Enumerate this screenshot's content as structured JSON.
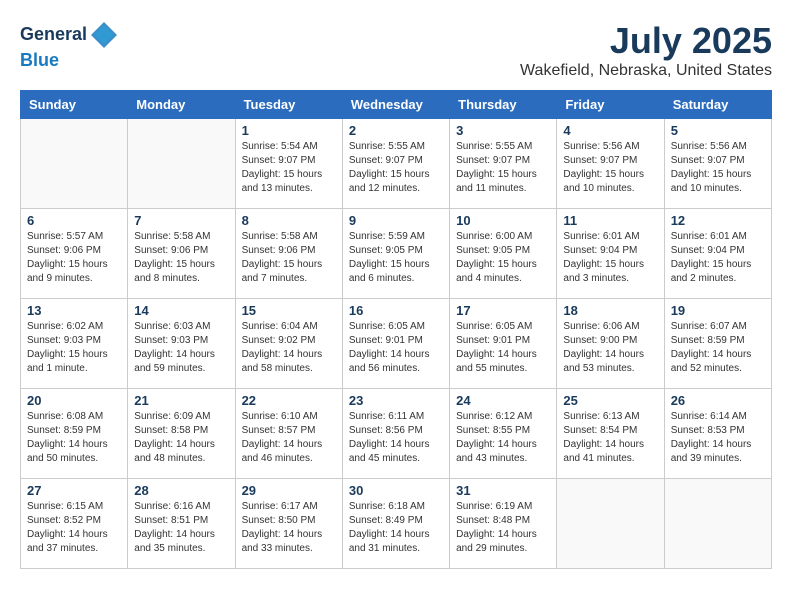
{
  "header": {
    "logo_line1": "General",
    "logo_line2": "Blue",
    "month_year": "July 2025",
    "location": "Wakefield, Nebraska, United States"
  },
  "days_of_week": [
    "Sunday",
    "Monday",
    "Tuesday",
    "Wednesday",
    "Thursday",
    "Friday",
    "Saturday"
  ],
  "weeks": [
    [
      {
        "num": "",
        "info": ""
      },
      {
        "num": "",
        "info": ""
      },
      {
        "num": "1",
        "info": "Sunrise: 5:54 AM\nSunset: 9:07 PM\nDaylight: 15 hours\nand 13 minutes."
      },
      {
        "num": "2",
        "info": "Sunrise: 5:55 AM\nSunset: 9:07 PM\nDaylight: 15 hours\nand 12 minutes."
      },
      {
        "num": "3",
        "info": "Sunrise: 5:55 AM\nSunset: 9:07 PM\nDaylight: 15 hours\nand 11 minutes."
      },
      {
        "num": "4",
        "info": "Sunrise: 5:56 AM\nSunset: 9:07 PM\nDaylight: 15 hours\nand 10 minutes."
      },
      {
        "num": "5",
        "info": "Sunrise: 5:56 AM\nSunset: 9:07 PM\nDaylight: 15 hours\nand 10 minutes."
      }
    ],
    [
      {
        "num": "6",
        "info": "Sunrise: 5:57 AM\nSunset: 9:06 PM\nDaylight: 15 hours\nand 9 minutes."
      },
      {
        "num": "7",
        "info": "Sunrise: 5:58 AM\nSunset: 9:06 PM\nDaylight: 15 hours\nand 8 minutes."
      },
      {
        "num": "8",
        "info": "Sunrise: 5:58 AM\nSunset: 9:06 PM\nDaylight: 15 hours\nand 7 minutes."
      },
      {
        "num": "9",
        "info": "Sunrise: 5:59 AM\nSunset: 9:05 PM\nDaylight: 15 hours\nand 6 minutes."
      },
      {
        "num": "10",
        "info": "Sunrise: 6:00 AM\nSunset: 9:05 PM\nDaylight: 15 hours\nand 4 minutes."
      },
      {
        "num": "11",
        "info": "Sunrise: 6:01 AM\nSunset: 9:04 PM\nDaylight: 15 hours\nand 3 minutes."
      },
      {
        "num": "12",
        "info": "Sunrise: 6:01 AM\nSunset: 9:04 PM\nDaylight: 15 hours\nand 2 minutes."
      }
    ],
    [
      {
        "num": "13",
        "info": "Sunrise: 6:02 AM\nSunset: 9:03 PM\nDaylight: 15 hours\nand 1 minute."
      },
      {
        "num": "14",
        "info": "Sunrise: 6:03 AM\nSunset: 9:03 PM\nDaylight: 14 hours\nand 59 minutes."
      },
      {
        "num": "15",
        "info": "Sunrise: 6:04 AM\nSunset: 9:02 PM\nDaylight: 14 hours\nand 58 minutes."
      },
      {
        "num": "16",
        "info": "Sunrise: 6:05 AM\nSunset: 9:01 PM\nDaylight: 14 hours\nand 56 minutes."
      },
      {
        "num": "17",
        "info": "Sunrise: 6:05 AM\nSunset: 9:01 PM\nDaylight: 14 hours\nand 55 minutes."
      },
      {
        "num": "18",
        "info": "Sunrise: 6:06 AM\nSunset: 9:00 PM\nDaylight: 14 hours\nand 53 minutes."
      },
      {
        "num": "19",
        "info": "Sunrise: 6:07 AM\nSunset: 8:59 PM\nDaylight: 14 hours\nand 52 minutes."
      }
    ],
    [
      {
        "num": "20",
        "info": "Sunrise: 6:08 AM\nSunset: 8:59 PM\nDaylight: 14 hours\nand 50 minutes."
      },
      {
        "num": "21",
        "info": "Sunrise: 6:09 AM\nSunset: 8:58 PM\nDaylight: 14 hours\nand 48 minutes."
      },
      {
        "num": "22",
        "info": "Sunrise: 6:10 AM\nSunset: 8:57 PM\nDaylight: 14 hours\nand 46 minutes."
      },
      {
        "num": "23",
        "info": "Sunrise: 6:11 AM\nSunset: 8:56 PM\nDaylight: 14 hours\nand 45 minutes."
      },
      {
        "num": "24",
        "info": "Sunrise: 6:12 AM\nSunset: 8:55 PM\nDaylight: 14 hours\nand 43 minutes."
      },
      {
        "num": "25",
        "info": "Sunrise: 6:13 AM\nSunset: 8:54 PM\nDaylight: 14 hours\nand 41 minutes."
      },
      {
        "num": "26",
        "info": "Sunrise: 6:14 AM\nSunset: 8:53 PM\nDaylight: 14 hours\nand 39 minutes."
      }
    ],
    [
      {
        "num": "27",
        "info": "Sunrise: 6:15 AM\nSunset: 8:52 PM\nDaylight: 14 hours\nand 37 minutes."
      },
      {
        "num": "28",
        "info": "Sunrise: 6:16 AM\nSunset: 8:51 PM\nDaylight: 14 hours\nand 35 minutes."
      },
      {
        "num": "29",
        "info": "Sunrise: 6:17 AM\nSunset: 8:50 PM\nDaylight: 14 hours\nand 33 minutes."
      },
      {
        "num": "30",
        "info": "Sunrise: 6:18 AM\nSunset: 8:49 PM\nDaylight: 14 hours\nand 31 minutes."
      },
      {
        "num": "31",
        "info": "Sunrise: 6:19 AM\nSunset: 8:48 PM\nDaylight: 14 hours\nand 29 minutes."
      },
      {
        "num": "",
        "info": ""
      },
      {
        "num": "",
        "info": ""
      }
    ]
  ]
}
